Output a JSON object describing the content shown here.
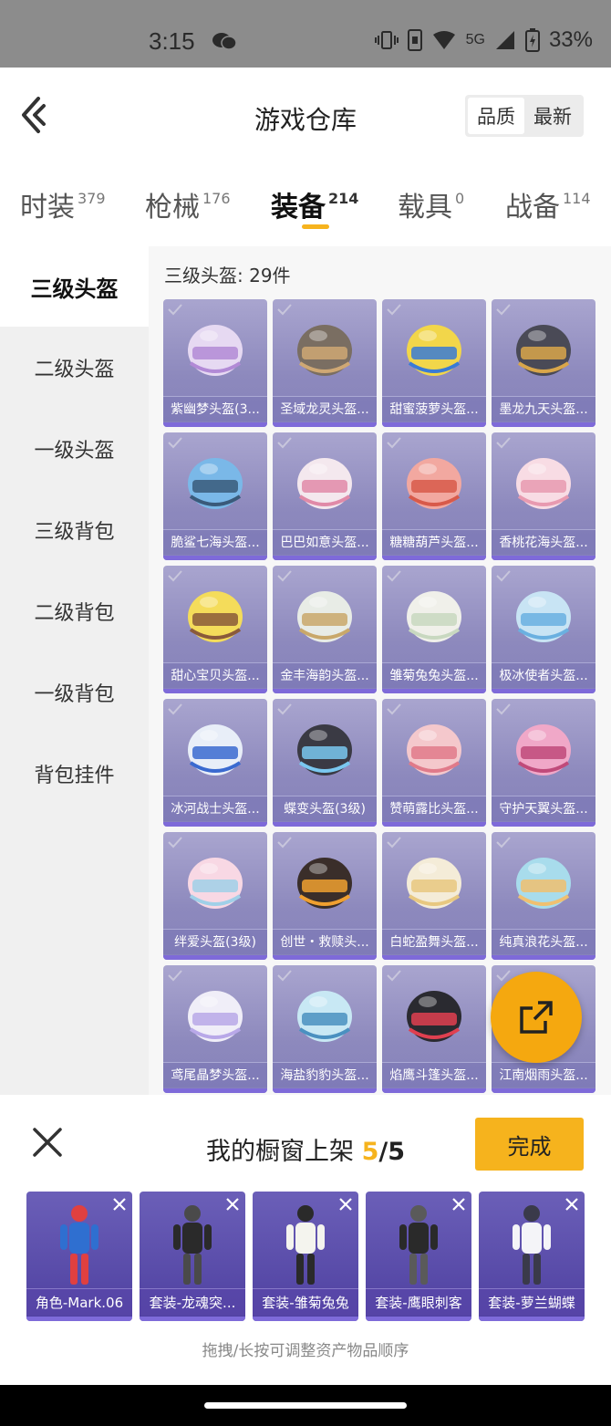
{
  "status_bar": {
    "time": "3:15",
    "network": "5G",
    "battery": "33%",
    "icons": [
      "wechat-icon",
      "vibrate-icon",
      "sim-icon",
      "wifi-icon",
      "signal-icon",
      "battery-icon"
    ]
  },
  "header": {
    "title": "游戏仓库",
    "sort_options": [
      "品质",
      "最新"
    ],
    "sort_selected": "品质"
  },
  "category_tabs": [
    {
      "label": "时装",
      "count": "379"
    },
    {
      "label": "枪械",
      "count": "176"
    },
    {
      "label": "装备",
      "count": "214",
      "active": true
    },
    {
      "label": "载具",
      "count": "0"
    },
    {
      "label": "战备",
      "count": "114"
    }
  ],
  "left_nav": {
    "items": [
      "三级头盔",
      "二级头盔",
      "一级头盔",
      "三级背包",
      "二级背包",
      "一级背包",
      "背包挂件"
    ],
    "selected": "三级头盔"
  },
  "main": {
    "count_label": "三级头盔: 29件",
    "items": [
      "紫幽梦头盔(3...",
      "圣域龙灵头盔...",
      "甜蜜菠萝头盔...",
      "墨龙九天头盔...",
      "脆鲨七海头盔...",
      "巴巴如意头盔...",
      "糖糖葫芦头盔...",
      "香桃花海头盔...",
      "甜心宝贝头盔...",
      "金丰海韵头盔...",
      "雏菊兔兔头盔...",
      "极冰使者头盔...",
      "冰河战士头盔...",
      "蝶变头盔(3级)",
      "赞萌露比头盔...",
      "守护天翼头盔...",
      "绊爱头盔(3级)",
      "创世・救赎头...",
      "白蛇盈舞头盔...",
      "纯真浪花头盔...",
      "鸢尾晶梦头盔...",
      "海盐豹豹头盔...",
      "焰鹰斗篷头盔...",
      "江南烟雨头盔..."
    ]
  },
  "bottom_sheet": {
    "title": "我的橱窗上架",
    "current": "5",
    "separator": "/",
    "total": "5",
    "done_label": "完成",
    "showcase": [
      "角色-Mark.06",
      "套装-龙魂突...",
      "套装-雏菊兔兔",
      "套装-鹰眼刺客",
      "套装-萝兰蝴蝶"
    ],
    "hint": "拖拽/长按可调整资产物品顺序"
  },
  "colors": {
    "accent": "#f6b31d",
    "card_bg": "#9a96c8",
    "showcase_bg": "#5a4cab"
  }
}
